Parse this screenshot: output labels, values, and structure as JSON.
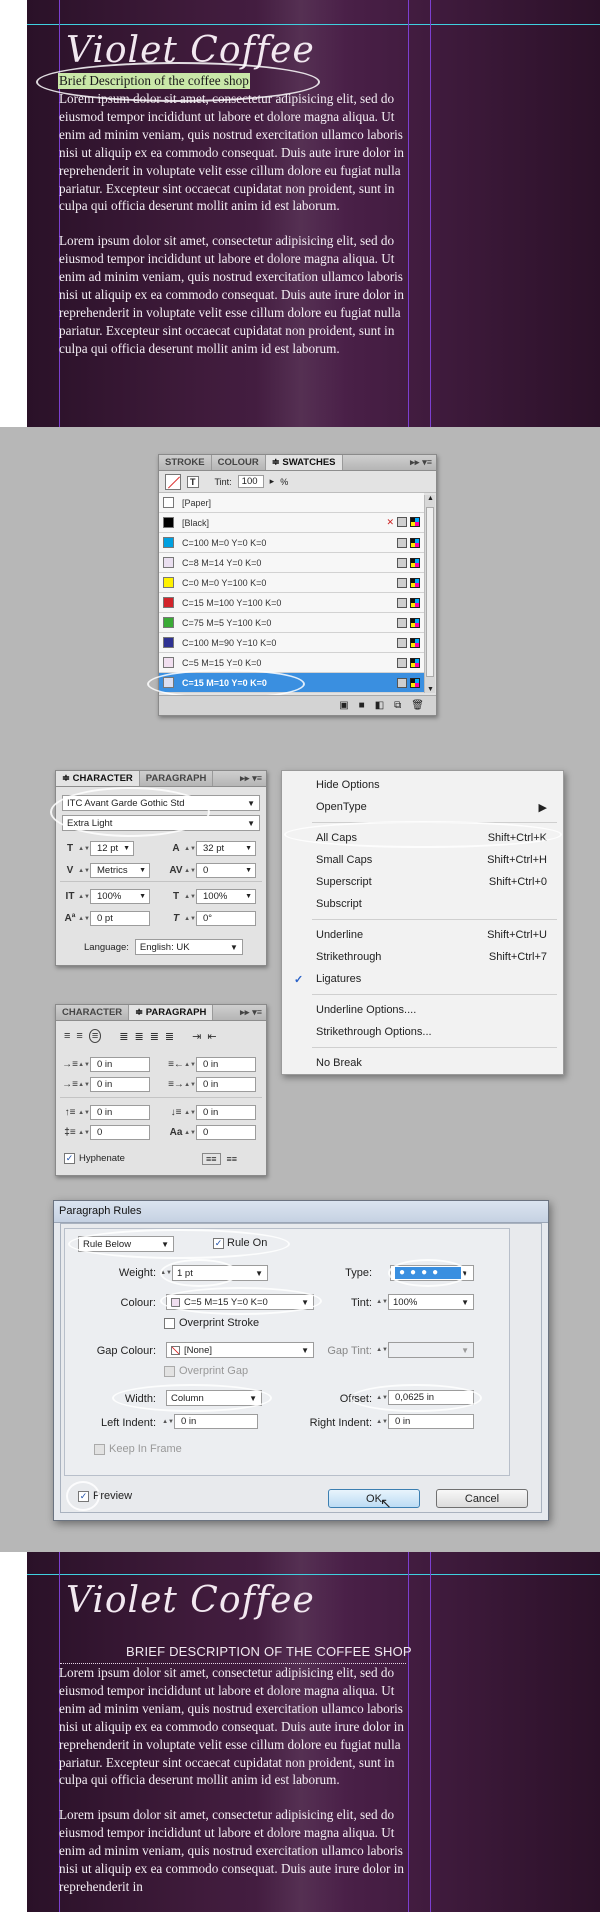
{
  "top_page": {
    "logo": "Violet Coffee",
    "selected_text": "Brief Description of the coffee shop",
    "paragraph1": "Lorem ipsum dolor sit amet, consectetur adipisicing elit, sed do eiusmod tempor incididunt ut labore et dolore magna aliqua. Ut enim ad minim veniam, quis nostrud exercitation ullamco laboris nisi ut aliquip ex ea commodo consequat. Duis aute irure dolor in reprehenderit in voluptate velit esse cillum dolore eu fugiat nulla pariatur. Excepteur sint occaecat cupidatat non proident, sunt in culpa qui officia deserunt mollit anim id est laborum.",
    "paragraph2": "Lorem ipsum dolor sit amet, consectetur adipisicing elit, sed do eiusmod tempor incididunt ut labore et dolore magna aliqua. Ut enim ad minim veniam, quis nostrud exercitation ullamco laboris nisi ut aliquip ex ea commodo consequat. Duis aute irure dolor in reprehenderit in voluptate velit esse cillum dolore eu fugiat nulla pariatur. Excepteur sint occaecat cupidatat non proident, sunt in culpa qui officia deserunt mollit anim id est laborum."
  },
  "swatches_panel": {
    "tabs": [
      "STROKE",
      "COLOUR",
      "SWATCHES"
    ],
    "tint_label": "Tint:",
    "tint_value": "100",
    "tint_unit": "%",
    "items": [
      {
        "name": "[Paper]",
        "color": "#ffffff"
      },
      {
        "name": "[Black]",
        "color": "#000000"
      },
      {
        "name": "C=100 M=0 Y=0 K=0",
        "color": "#00a0e0"
      },
      {
        "name": "C=8 M=14 Y=0 K=0",
        "color": "#eadff0"
      },
      {
        "name": "C=0 M=0 Y=100 K=0",
        "color": "#fff200"
      },
      {
        "name": "C=15 M=100 Y=100 K=0",
        "color": "#d2232a"
      },
      {
        "name": "C=75 M=5 Y=100 K=0",
        "color": "#3aaa35"
      },
      {
        "name": "C=100 M=90 Y=10 K=0",
        "color": "#2e3192"
      },
      {
        "name": "C=5 M=15 Y=0 K=0",
        "color": "#f1dff0"
      },
      {
        "name": "C=15 M=10 Y=0 K=0",
        "color": "#dcdff0"
      }
    ]
  },
  "character_panel": {
    "tabs": [
      "CHARACTER",
      "PARAGRAPH"
    ],
    "font_family": "ITC Avant Garde Gothic Std",
    "font_style": "Extra Light",
    "font_size": "12 pt",
    "leading": "32 pt",
    "kerning": "Metrics",
    "tracking": "0",
    "vertical_scale": "100%",
    "horizontal_scale": "100%",
    "baseline_shift": "0 pt",
    "skew": "0°",
    "language_label": "Language:",
    "language": "English: UK"
  },
  "context_menu": {
    "items": [
      {
        "label": "Hide Options",
        "shortcut": ""
      },
      {
        "label": "OpenType",
        "shortcut": "▶"
      },
      {
        "label": "All Caps",
        "shortcut": "Shift+Ctrl+K"
      },
      {
        "label": "Small Caps",
        "shortcut": "Shift+Ctrl+H"
      },
      {
        "label": "Superscript",
        "shortcut": "Shift+Ctrl+0"
      },
      {
        "label": "Subscript",
        "shortcut": ""
      },
      {
        "label": "Underline",
        "shortcut": "Shift+Ctrl+U"
      },
      {
        "label": "Strikethrough",
        "shortcut": "Shift+Ctrl+7"
      },
      {
        "label": "Ligatures",
        "shortcut": "",
        "checked": true
      },
      {
        "label": "Underline Options....",
        "shortcut": ""
      },
      {
        "label": "Strikethrough Options...",
        "shortcut": ""
      },
      {
        "label": "No Break",
        "shortcut": ""
      }
    ]
  },
  "paragraph_panel": {
    "tabs": [
      "CHARACTER",
      "PARAGRAPH"
    ],
    "left_indent": "0 in",
    "right_indent": "0 in",
    "first_line_indent": "0 in",
    "last_line_indent": "0 in",
    "space_before": "0 in",
    "space_after": "0 in",
    "drop_cap_lines": "0",
    "drop_cap_chars": "0",
    "hyphenate_label": "Hyphenate"
  },
  "paragraph_rules": {
    "title": "Paragraph Rules",
    "rule_select": "Rule Below",
    "rule_on": "Rule On",
    "weight_label": "Weight:",
    "weight": "1 pt",
    "type_label": "Type:",
    "colour_label": "Colour:",
    "colour": "C=5 M=15 Y=0 K=0",
    "tint_label": "Tint:",
    "tint": "100%",
    "overprint_stroke": "Overprint Stroke",
    "gap_colour_label": "Gap Colour:",
    "gap_colour": "[None]",
    "gap_tint_label": "Gap Tint:",
    "overprint_gap": "Overprint Gap",
    "width_label": "Width:",
    "width": "Column",
    "offset_label": "Offset:",
    "offset": "0,0625 in",
    "left_indent_label": "Left Indent:",
    "left_indent": "0 in",
    "right_indent_label": "Right Indent:",
    "right_indent": "0 in",
    "keep_in_frame": "Keep In Frame",
    "preview": "Preview",
    "ok": "OK",
    "cancel": "Cancel"
  },
  "bottom_page": {
    "logo": "Violet Coffee",
    "heading_caps": "BRIEF DESCRIPTION OF THE COFFEE SHOP",
    "paragraph1": "Lorem ipsum dolor sit amet, consectetur adipisicing elit, sed do eiusmod tempor incididunt ut labore et dolore magna aliqua. Ut enim ad minim veniam, quis nostrud exercitation ullamco laboris nisi ut aliquip ex ea commodo consequat. Duis aute irure dolor in reprehenderit in voluptate velit esse cillum dolore eu fugiat nulla pariatur. Excepteur sint occaecat cupidatat non proident, sunt in culpa qui officia deserunt mollit anim id est laborum.",
    "paragraph2": "Lorem ipsum dolor sit amet, consectetur adipisicing elit, sed do eiusmod tempor incididunt ut labore et dolore magna aliqua. Ut enim ad minim veniam, quis nostrud exercitation ullamco laboris nisi ut aliquip ex ea commodo consequat. Duis aute irure dolor in reprehenderit in"
  }
}
